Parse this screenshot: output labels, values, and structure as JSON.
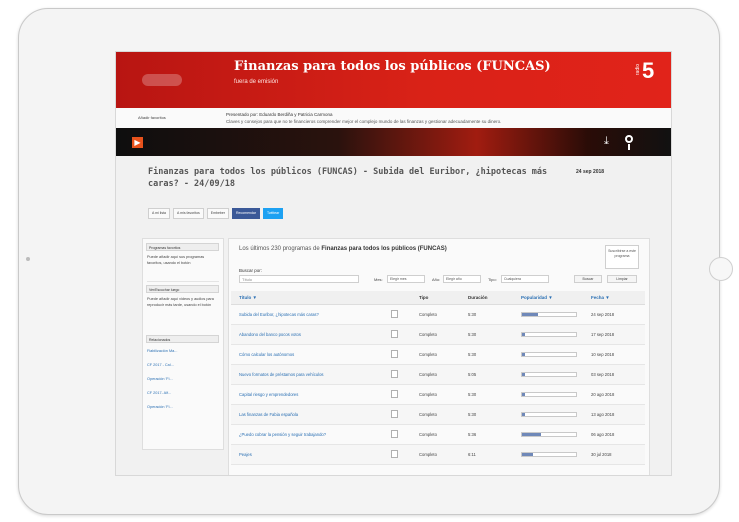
{
  "header": {
    "title": "Finanzas para todos los públicos (FUNCAS)",
    "subtitle": "fuera de emisión",
    "radio_label": "radio",
    "radio_number": "5"
  },
  "info": {
    "fav_button": "Añadir favoritos",
    "line1": "Presentado por: Eduardo Berdiña y Patricia Carmona",
    "line2": "Claves y consejos para que no te financieros comprender mejor el complejo mundo de las finanzas y gestionar adecuadamente su dinero."
  },
  "player": {
    "play": "▶",
    "download": "⤓"
  },
  "episode": {
    "title": "Finanzas para todos los públicos (FUNCAS) - Subida del Euribor, ¿hipotecas más caras? - 24/09/18",
    "date": "24 sep 2018",
    "actions": [
      "A mi lista",
      "A mis favoritos",
      "Embeber",
      "Recomendar",
      "Twittear"
    ]
  },
  "sidebar": {
    "fav_title": "Programas favoritos",
    "fav_text": "Puede añadir aquí sus programas favoritos, usando el botón",
    "mylist_title": "Ver/Escuchar luego",
    "mylist_text": "Puede añadir aquí videos y audios para reproducir más tarde, usando el botón",
    "related_title": "Relacionados",
    "links": [
      "Fiabilización Ma...",
      "CF 2017 - Cal...",
      "Operación 'Fi...",
      "CF 2017- Alf...",
      "Operación 'Fi..."
    ]
  },
  "main": {
    "heading_prefix": "Los últimos 230 programas de",
    "heading_bold": "Finanzas para todos los públicos (FUNCAS)",
    "subscribe": "Suscribirse a este programa",
    "search_label": "Buscar por:",
    "search_placeholder": "Título",
    "filters": {
      "month_label": "Mes:",
      "month_value": "Elegir mes",
      "year_label": "Año:",
      "year_value": "Elegir año",
      "type_label": "Tipo:",
      "type_value": "Cualquiera",
      "search_btn": "Buscar",
      "clear_btn": "Limpiar"
    },
    "columns": {
      "title": "Título ▼",
      "type": "Tipo",
      "duration": "Duración",
      "popularity": "Popularidad ▼",
      "date": "Fecha ▼"
    },
    "rows": [
      {
        "title": "Subida del Euribor, ¿hipotecas más caras?",
        "type": "Completo",
        "duration": "5:30",
        "popularity": 0.3,
        "date": "24 sep 2018"
      },
      {
        "title": "Abandono del banco pocos votos",
        "type": "Completo",
        "duration": "5:30",
        "popularity": 0.05,
        "date": "17 sep 2018"
      },
      {
        "title": "Cómo calcular los autónomos",
        "type": "Completo",
        "duration": "5:30",
        "popularity": 0.05,
        "date": "10 sep 2018"
      },
      {
        "title": "Nuevo formatos de préstamos para vehículos",
        "type": "Completo",
        "duration": "5:05",
        "popularity": 0.05,
        "date": "03 sep 2018"
      },
      {
        "title": "Capital riesgo y emprendedores",
        "type": "Completo",
        "duration": "5:30",
        "popularity": 0.05,
        "date": "20 ago 2018"
      },
      {
        "title": "Las finanzas de Fabia española",
        "type": "Completo",
        "duration": "5:30",
        "popularity": 0.05,
        "date": "13 ago 2018"
      },
      {
        "title": "¿Puedo cobrar la pensión y seguir trabajando?",
        "type": "Completo",
        "duration": "5:36",
        "popularity": 0.35,
        "date": "06 ago 2018"
      },
      {
        "title": "Peajes",
        "type": "Completo",
        "duration": "6:11",
        "popularity": 0.2,
        "date": "30 jul 2018"
      }
    ]
  }
}
